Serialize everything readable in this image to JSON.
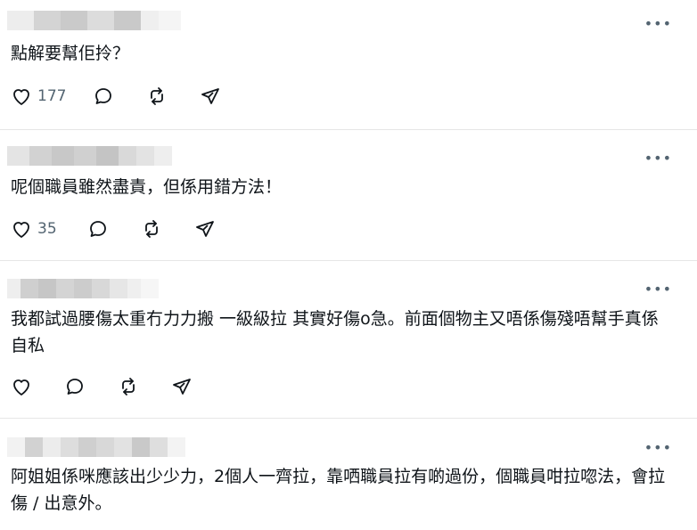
{
  "posts": [
    {
      "text": "點解要幫佢拎？",
      "likes": "177"
    },
    {
      "text": "呢個職員雖然盡責，但係用錯方法！",
      "likes": "35"
    },
    {
      "text": "我都試過腰傷太重冇力力搬 一級級拉 其實好傷o急。前面個物主又唔係傷殘唔幫手真係自私",
      "likes": ""
    },
    {
      "text": "阿姐姐係咪應該出少少力，2個人一齊拉，靠哂職員拉有啲過份，個職員咁拉唿法，會拉傷 / 出意外。",
      "likes": ""
    }
  ],
  "icons": {
    "more": "more-horizontal-icon",
    "like": "heart-icon",
    "reply": "comment-icon",
    "repost": "repost-icon",
    "share": "send-icon"
  },
  "colors": {
    "text": "#0f1419",
    "muted": "#536471",
    "divider": "#e6e6e6",
    "background": "#ffffff"
  }
}
